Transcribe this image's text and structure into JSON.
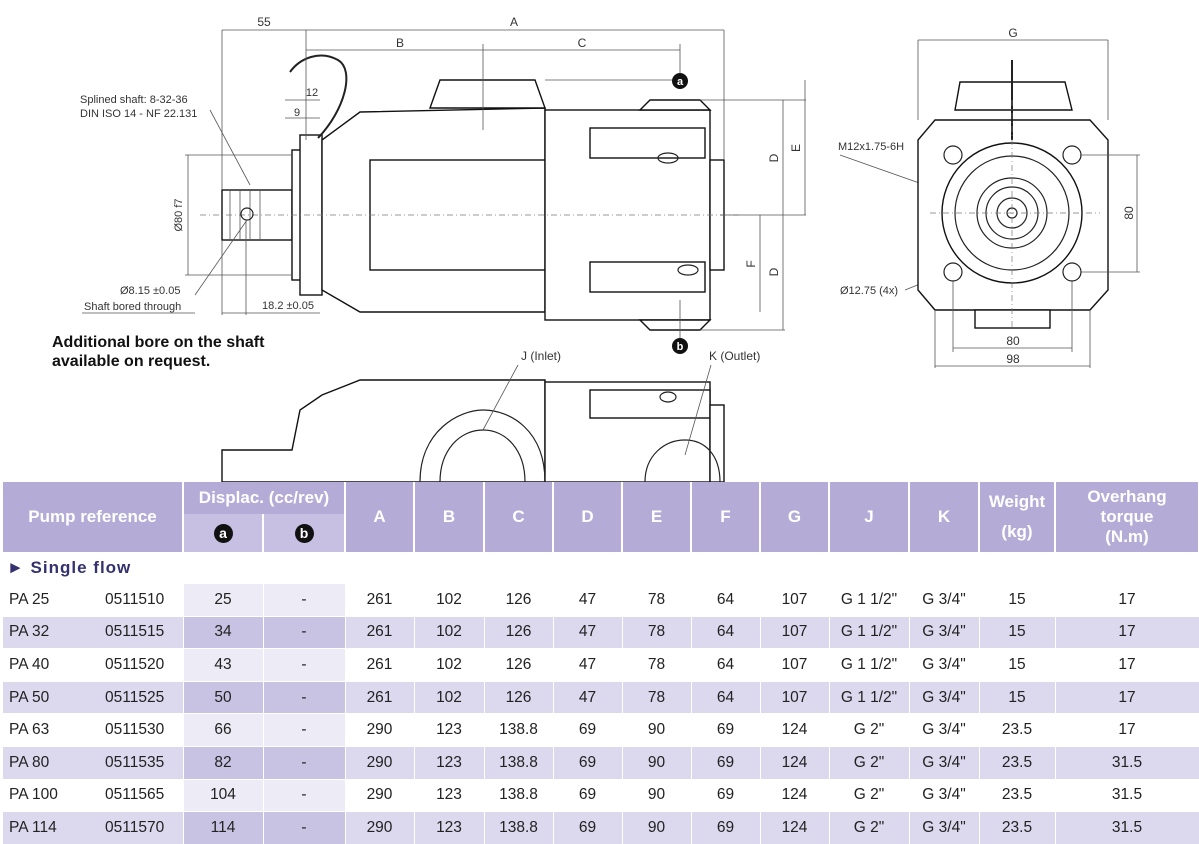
{
  "drawing": {
    "dims": {
      "d55": "55",
      "dA": "A",
      "dB": "B",
      "dC": "C",
      "d12": "12",
      "d9": "9",
      "dD1": "D",
      "dE": "E",
      "dF": "F",
      "dD2": "D",
      "dG": "G",
      "d80v": "80",
      "d80h": "80",
      "d98": "98",
      "d182": "18.2 ±0.05",
      "phi80": "Ø80 f7"
    },
    "labels": {
      "splined1": "Splined shaft: 8-32-36",
      "splined2": "DIN ISO 14 - NF 22.131",
      "bore1": "Ø8.15 ±0.05",
      "bore2": "Shaft bored through",
      "m12": "M12x1.75-6H",
      "holes": "Ø12.75 (4x)",
      "inlet": "J (Inlet)",
      "outlet": "K (Outlet)",
      "mark_a": "a",
      "mark_b": "b"
    },
    "note_line1": "Additional bore on the shaft",
    "note_line2": "available on request."
  },
  "table": {
    "headers": {
      "pump_reference": "Pump reference",
      "displac": "Displac. (cc/rev)",
      "sub_a": "a",
      "sub_b": "b",
      "A": "A",
      "B": "B",
      "C": "C",
      "D": "D",
      "E": "E",
      "F": "F",
      "G": "G",
      "J": "J",
      "K": "K",
      "weight1": "Weight",
      "weight2": "(kg)",
      "torque1": "Overhang",
      "torque2": "torque",
      "torque3": "(N.m)"
    },
    "section": "► Single flow",
    "rows": [
      {
        "name": "PA 25",
        "code": "0511510",
        "a": "25",
        "b": "-",
        "A": "261",
        "B": "102",
        "C": "126",
        "D": "47",
        "E": "78",
        "F": "64",
        "G": "107",
        "J": "G 1 1/2\"",
        "K": "G 3/4\"",
        "weight": "15",
        "torque": "17"
      },
      {
        "name": "PA 32",
        "code": "0511515",
        "a": "34",
        "b": "-",
        "A": "261",
        "B": "102",
        "C": "126",
        "D": "47",
        "E": "78",
        "F": "64",
        "G": "107",
        "J": "G 1 1/2\"",
        "K": "G 3/4\"",
        "weight": "15",
        "torque": "17"
      },
      {
        "name": "PA 40",
        "code": "0511520",
        "a": "43",
        "b": "-",
        "A": "261",
        "B": "102",
        "C": "126",
        "D": "47",
        "E": "78",
        "F": "64",
        "G": "107",
        "J": "G 1 1/2\"",
        "K": "G 3/4\"",
        "weight": "15",
        "torque": "17"
      },
      {
        "name": "PA 50",
        "code": "0511525",
        "a": "50",
        "b": "-",
        "A": "261",
        "B": "102",
        "C": "126",
        "D": "47",
        "E": "78",
        "F": "64",
        "G": "107",
        "J": "G 1 1/2\"",
        "K": "G 3/4\"",
        "weight": "15",
        "torque": "17"
      },
      {
        "name": "PA 63",
        "code": "0511530",
        "a": "66",
        "b": "-",
        "A": "290",
        "B": "123",
        "C": "138.8",
        "D": "69",
        "E": "90",
        "F": "69",
        "G": "124",
        "J": "G 2\"",
        "K": "G 3/4\"",
        "weight": "23.5",
        "torque": "17"
      },
      {
        "name": "PA 80",
        "code": "0511535",
        "a": "82",
        "b": "-",
        "A": "290",
        "B": "123",
        "C": "138.8",
        "D": "69",
        "E": "90",
        "F": "69",
        "G": "124",
        "J": "G 2\"",
        "K": "G 3/4\"",
        "weight": "23.5",
        "torque": "31.5"
      },
      {
        "name": "PA 100",
        "code": "0511565",
        "a": "104",
        "b": "-",
        "A": "290",
        "B": "123",
        "C": "138.8",
        "D": "69",
        "E": "90",
        "F": "69",
        "G": "124",
        "J": "G 2\"",
        "K": "G 3/4\"",
        "weight": "23.5",
        "torque": "31.5"
      },
      {
        "name": "PA 114",
        "code": "0511570",
        "a": "114",
        "b": "-",
        "A": "290",
        "B": "123",
        "C": "138.8",
        "D": "69",
        "E": "90",
        "F": "69",
        "G": "124",
        "J": "G 2\"",
        "K": "G 3/4\"",
        "weight": "23.5",
        "torque": "31.5"
      }
    ]
  }
}
